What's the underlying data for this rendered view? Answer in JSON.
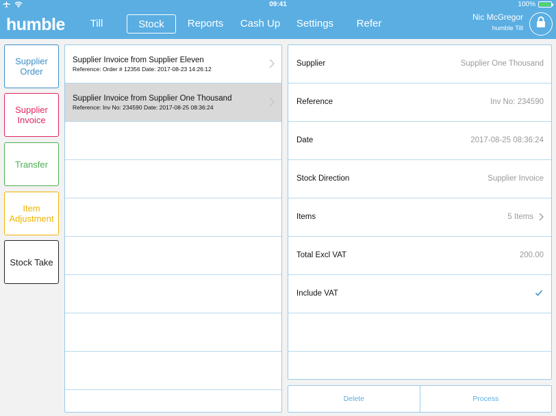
{
  "status": {
    "time": "09:41",
    "battery": "100%",
    "battery_level": 1.0
  },
  "brand": {
    "logo": "humble",
    "accent": "#5aaee2"
  },
  "nav": [
    {
      "label": "Till",
      "active": false
    },
    {
      "label": "Stock",
      "active": true
    },
    {
      "label": "Reports",
      "active": false
    },
    {
      "label": "Cash Up",
      "active": false
    },
    {
      "label": "Settings",
      "active": false
    },
    {
      "label": "Refer",
      "active": false
    }
  ],
  "user": {
    "name": "Nic McGregor",
    "till": "humble Till"
  },
  "side_buttons": [
    {
      "label": "Supplier Order",
      "color": "#3d8fc6"
    },
    {
      "label": "Supplier Invoice",
      "color": "#e0245e"
    },
    {
      "label": "Transfer",
      "color": "#4caf50"
    },
    {
      "label": "Item Adjustment",
      "color": "#f0b400"
    },
    {
      "label": "Stock Take",
      "color": "#222222"
    }
  ],
  "list": [
    {
      "title": "Supplier Invoice from Supplier Eleven",
      "subtitle": "Reference: Order # 12356 Date: 2017-08-23 14:26:12",
      "selected": false
    },
    {
      "title": "Supplier Invoice from Supplier One Thousand",
      "subtitle": "Reference: Inv No: 234590 Date: 2017-08-25 08:36:24",
      "selected": true
    }
  ],
  "detail": {
    "supplier_label": "Supplier",
    "supplier_value": "Supplier One Thousand",
    "reference_label": "Reference",
    "reference_value": "Inv No: 234590",
    "date_label": "Date",
    "date_value": "2017-08-25 08:36:24",
    "direction_label": "Stock Direction",
    "direction_value": "Supplier Invoice",
    "items_label": "Items",
    "items_value": "5 Items",
    "total_label": "Total Excl VAT",
    "total_value": "200.00",
    "vat_label": "Include VAT",
    "vat_checked": true
  },
  "actions": {
    "delete_label": "Delete",
    "process_label": "Process"
  }
}
